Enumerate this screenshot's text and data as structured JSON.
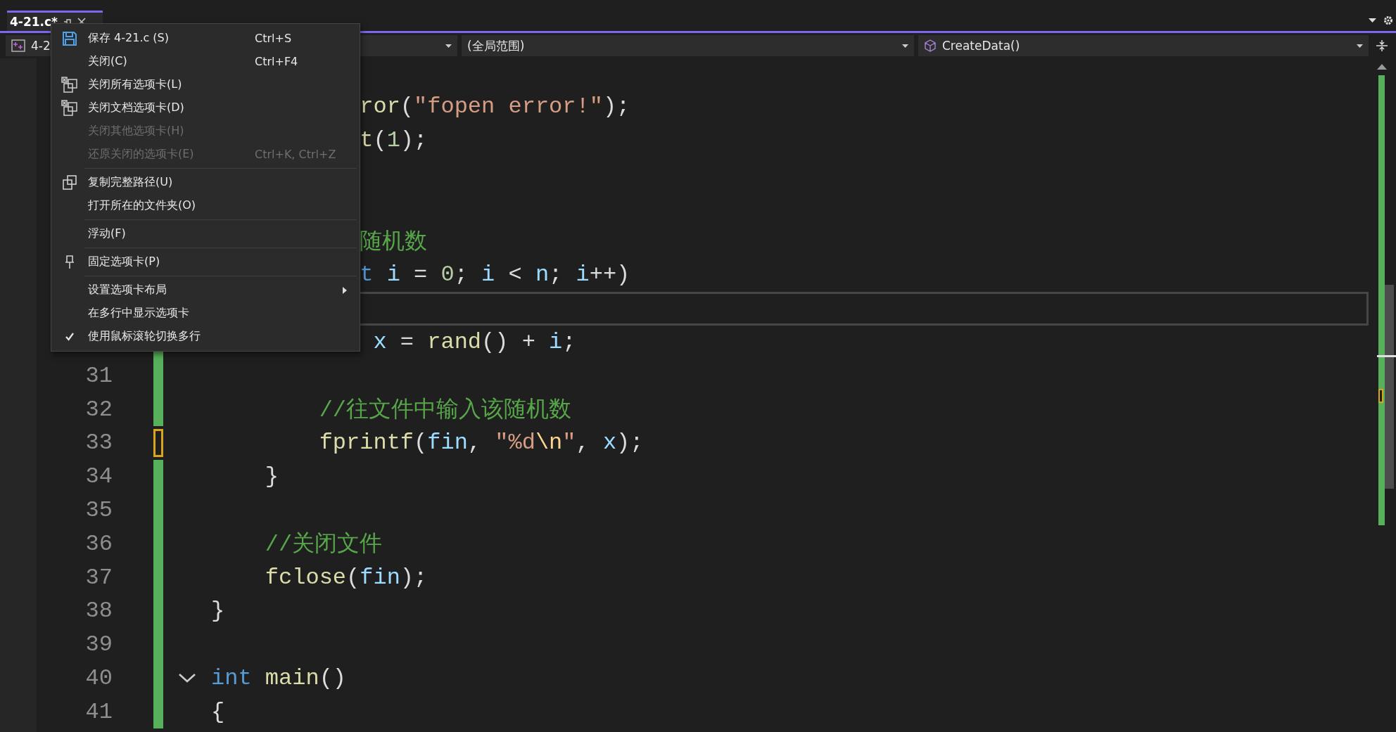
{
  "tab": {
    "title": "4-21.c*",
    "selected": true
  },
  "nav": [
    {
      "kind": "project",
      "text": "4-2"
    },
    {
      "kind": "scope",
      "text": "(全局范围)"
    },
    {
      "kind": "member",
      "text": "CreateData()"
    }
  ],
  "code_lines": [
    {
      "current": false,
      "tokens": [
        {
          "kind": "func",
          "text": "           ror"
        },
        {
          "kind": "plain",
          "text": "("
        },
        {
          "kind": "string",
          "text": "\"fopen error!\""
        },
        {
          "kind": "plain",
          "text": ");"
        }
      ]
    },
    {
      "current": false,
      "tokens": [
        {
          "kind": "func",
          "text": "           t"
        },
        {
          "kind": "plain",
          "text": "("
        },
        {
          "kind": "number",
          "text": "1"
        },
        {
          "kind": "plain",
          "text": ");"
        }
      ]
    },
    {
      "current": false
    },
    {
      "current": false
    },
    {
      "current": false,
      "tokens": [
        {
          "kind": "comment",
          "text": "           随机数"
        }
      ]
    },
    {
      "current": false,
      "tokens": [
        {
          "kind": "keyword",
          "text": "           t"
        },
        {
          "kind": "ident",
          "text": " i"
        },
        {
          "kind": "plain",
          "text": " = "
        },
        {
          "kind": "number",
          "text": "0"
        },
        {
          "kind": "plain",
          "text": "; "
        },
        {
          "kind": "ident",
          "text": "i"
        },
        {
          "kind": "plain",
          "text": " < "
        },
        {
          "kind": "ident",
          "text": "n"
        },
        {
          "kind": "plain",
          "text": "; "
        },
        {
          "kind": "ident",
          "text": "i"
        },
        {
          "kind": "plain",
          "text": "++)"
        }
      ]
    },
    {
      "current": true
    },
    {
      "current": false,
      "unsaved": false,
      "tokens": [
        {
          "kind": "ident",
          "text": "            x"
        },
        {
          "kind": "plain",
          "text": " = "
        },
        {
          "kind": "func",
          "text": "rand"
        },
        {
          "kind": "plain",
          "text": "() + "
        },
        {
          "kind": "ident",
          "text": "i"
        },
        {
          "kind": "plain",
          "text": ";"
        }
      ]
    },
    {
      "number": "31",
      "current": false,
      "unsaved": false
    },
    {
      "number": "32",
      "current": false,
      "unsaved": false,
      "tokens": [
        {
          "kind": "comment",
          "text": "        //往文件中输入该随机数"
        }
      ]
    },
    {
      "number": "33",
      "current": false,
      "unsaved": true,
      "tokens": [
        {
          "kind": "func",
          "text": "        fprintf"
        },
        {
          "kind": "plain",
          "text": "("
        },
        {
          "kind": "ident",
          "text": "fin"
        },
        {
          "kind": "plain",
          "text": ", "
        },
        {
          "kind": "string",
          "text": "\"%d"
        },
        {
          "kind": "escape",
          "text": "\\n"
        },
        {
          "kind": "string",
          "text": "\""
        },
        {
          "kind": "plain",
          "text": ", "
        },
        {
          "kind": "ident",
          "text": "x"
        },
        {
          "kind": "plain",
          "text": ");"
        }
      ]
    },
    {
      "number": "34",
      "current": false,
      "unsaved": false,
      "tokens": [
        {
          "kind": "plain",
          "text": "    }"
        }
      ]
    },
    {
      "number": "35",
      "current": false,
      "unsaved": false
    },
    {
      "number": "36",
      "current": false,
      "unsaved": false,
      "tokens": [
        {
          "kind": "comment",
          "text": "    //关闭文件"
        }
      ]
    },
    {
      "number": "37",
      "current": false,
      "unsaved": false,
      "tokens": [
        {
          "kind": "func",
          "text": "    fclose"
        },
        {
          "kind": "plain",
          "text": "("
        },
        {
          "kind": "ident",
          "text": "fin"
        },
        {
          "kind": "plain",
          "text": ");"
        }
      ]
    },
    {
      "number": "38",
      "current": false,
      "unsaved": false,
      "tokens": [
        {
          "kind": "plain",
          "text": "}"
        }
      ]
    },
    {
      "number": "39",
      "current": false,
      "unsaved": false
    },
    {
      "number": "40",
      "current": false,
      "unsaved": false,
      "expanded": true,
      "tokens": [
        {
          "kind": "keyword",
          "text": "int"
        },
        {
          "kind": "func",
          "text": " main"
        },
        {
          "kind": "plain",
          "text": "()"
        }
      ]
    },
    {
      "number": "41",
      "current": false,
      "unsaved": false,
      "tokens": [
        {
          "kind": "plain",
          "text": "{"
        }
      ]
    }
  ],
  "context_menu": [
    {
      "kind": "save",
      "label": "保存 4-21.c (S)",
      "shortcut": "Ctrl+S",
      "disabled": false,
      "checked": false,
      "submenu": false
    },
    {
      "kind": "plain",
      "label": "关闭(C)",
      "shortcut": "Ctrl+F4",
      "disabled": false,
      "checked": false,
      "submenu": false
    },
    {
      "kind": "close-tabs",
      "label": "关闭所有选项卡(L)",
      "disabled": false,
      "checked": false,
      "submenu": false
    },
    {
      "kind": "close-tabs",
      "label": "关闭文档选项卡(D)",
      "disabled": false,
      "checked": false,
      "submenu": false
    },
    {
      "kind": "plain",
      "label": "关闭其他选项卡(H)",
      "disabled": true,
      "checked": false,
      "submenu": false
    },
    {
      "kind": "plain",
      "label": "还原关闭的选项卡(E)",
      "shortcut": "Ctrl+K, Ctrl+Z",
      "disabled": true,
      "checked": false,
      "submenu": false
    },
    {
      "kind": "separator"
    },
    {
      "kind": "copy",
      "label": "复制完整路径(U)",
      "disabled": false,
      "checked": false,
      "submenu": false
    },
    {
      "kind": "plain",
      "label": "打开所在的文件夹(O)",
      "disabled": false,
      "checked": false,
      "submenu": false
    },
    {
      "kind": "separator"
    },
    {
      "kind": "plain",
      "label": "浮动(F)",
      "disabled": false,
      "checked": false,
      "submenu": false
    },
    {
      "kind": "separator"
    },
    {
      "kind": "pin",
      "label": "固定选项卡(P)",
      "disabled": false,
      "checked": false,
      "submenu": false
    },
    {
      "kind": "separator"
    },
    {
      "kind": "plain",
      "label": "设置选项卡布局",
      "disabled": false,
      "checked": false,
      "submenu": true
    },
    {
      "kind": "plain",
      "label": "在多行中显示选项卡",
      "disabled": false,
      "checked": false,
      "submenu": false
    },
    {
      "kind": "plain",
      "label": "使用鼠标滚轮切换多行",
      "disabled": false,
      "checked": true,
      "submenu": false
    }
  ]
}
